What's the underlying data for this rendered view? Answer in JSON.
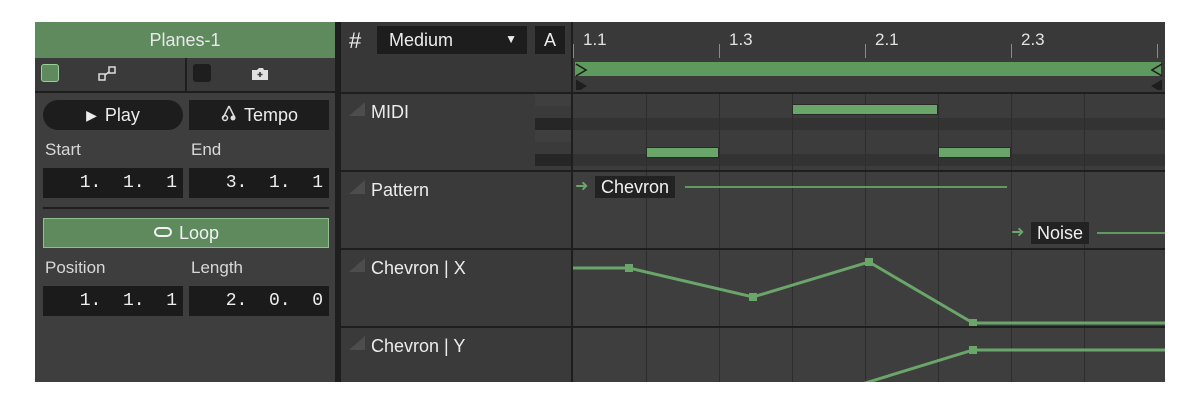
{
  "clip": {
    "title": "Planes-1",
    "play_label": "Play",
    "tempo_label": "Tempo",
    "start_label": "Start",
    "end_label": "End",
    "start": [
      "1.",
      "1.",
      "1"
    ],
    "end": [
      "3.",
      "1.",
      "1"
    ],
    "loop_label": "Loop",
    "position_label": "Position",
    "length_label": "Length",
    "position": [
      "1.",
      "1.",
      "1"
    ],
    "length": [
      "2.",
      "0.",
      "0"
    ]
  },
  "toolbar": {
    "grid_icon": "grid-hash-icon",
    "grid_value": "Medium",
    "auto_label": "A"
  },
  "ruler": {
    "labels": [
      "1.1",
      "1.3",
      "2.1",
      "2.3"
    ]
  },
  "tracks": [
    {
      "name": "MIDI"
    },
    {
      "name": "Pattern"
    },
    {
      "name": "Chevron | X"
    },
    {
      "name": "Chevron | Y"
    }
  ],
  "patterns": [
    "Chevron",
    "Noise"
  ],
  "colors": {
    "accent": "#5e8a5e",
    "note": "#6aa56a",
    "panel": "#3e3e3e",
    "field": "#1d1d1d"
  }
}
